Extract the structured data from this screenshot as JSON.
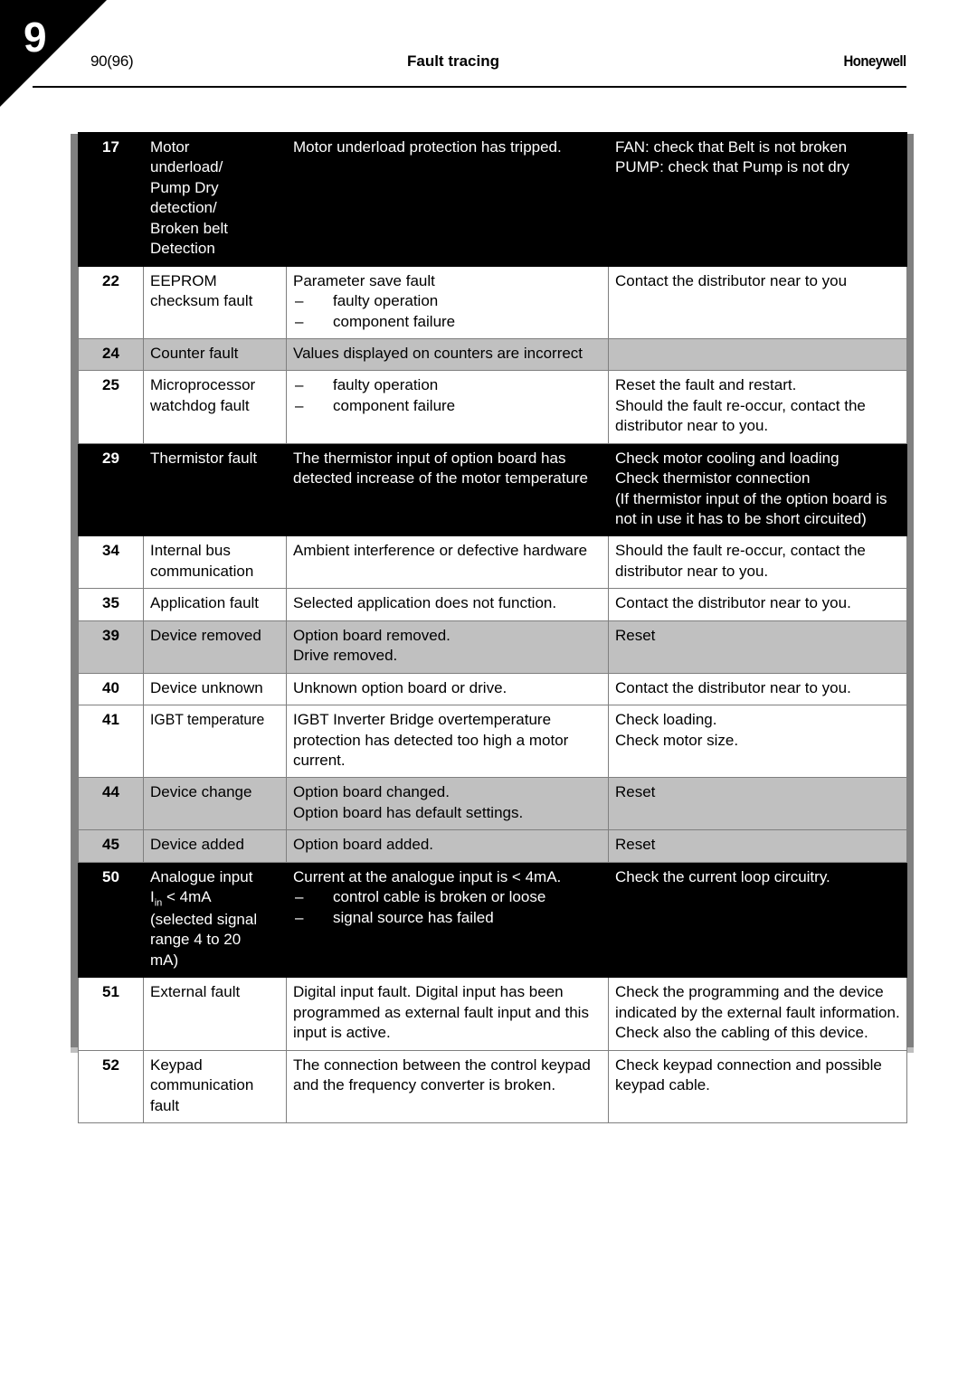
{
  "header": {
    "chapter_number": "9",
    "page_number": "90(96)",
    "title": "Fault tracing",
    "brand": "Honeywell"
  },
  "table": {
    "rows": [
      {
        "code": "17",
        "shade": "black",
        "name_lines": [
          "Motor",
          "underload/",
          "Pump Dry",
          "detection/",
          "Broken belt",
          "Detection"
        ],
        "desc_lines": [
          "Motor underload protection has tripped."
        ],
        "desc_bullets": [],
        "help_lines": [
          "FAN: check that Belt is not broken",
          "PUMP: check that Pump is not dry"
        ]
      },
      {
        "code": "22",
        "shade": "white",
        "name_lines": [
          "EEPROM",
          "checksum fault"
        ],
        "desc_lines": [
          "Parameter save fault"
        ],
        "desc_bullets": [
          "faulty operation",
          "component failure"
        ],
        "help_lines": [
          "Contact the distributor near to you"
        ]
      },
      {
        "code": "24",
        "shade": "gray",
        "name_lines": [
          "Counter fault"
        ],
        "desc_lines": [
          "Values displayed on counters are incorrect"
        ],
        "desc_bullets": [],
        "help_lines": []
      },
      {
        "code": "25",
        "shade": "white",
        "name_lines": [
          "Microprocessor",
          "watchdog fault"
        ],
        "desc_lines": [],
        "desc_bullets": [
          "faulty operation",
          "component failure"
        ],
        "help_lines": [
          "Reset the fault and restart.",
          "Should the fault re-occur, contact the distributor near to you."
        ]
      },
      {
        "code": "29",
        "shade": "black",
        "name_lines": [
          "Thermistor fault"
        ],
        "desc_lines": [
          "The thermistor input of option board has detected increase of the motor temperature"
        ],
        "desc_bullets": [],
        "help_lines": [
          "Check motor cooling and loading",
          "Check thermistor connection",
          "(If thermistor input of the option board is not in use it has to be short circuited)"
        ]
      },
      {
        "code": "34",
        "shade": "white",
        "name_lines": [
          "Internal bus",
          "communication"
        ],
        "desc_lines": [
          "Ambient interference or defective hardware"
        ],
        "desc_bullets": [],
        "help_lines": [
          "Should the fault re-occur, contact the distributor near to you."
        ]
      },
      {
        "code": "35",
        "shade": "white",
        "name_lines": [
          "Application fault"
        ],
        "desc_lines": [
          "Selected application does not function."
        ],
        "desc_bullets": [],
        "help_lines": [
          "Contact the distributor near to you."
        ]
      },
      {
        "code": "39",
        "shade": "gray",
        "name_lines": [
          "Device removed"
        ],
        "desc_lines": [
          "Option board removed.",
          "Drive removed."
        ],
        "desc_bullets": [],
        "help_lines": [
          "Reset"
        ]
      },
      {
        "code": "40",
        "shade": "white",
        "name_lines": [
          "Device unknown"
        ],
        "desc_lines": [
          "Unknown option board or drive."
        ],
        "desc_bullets": [],
        "help_lines": [
          "Contact the distributor near to you."
        ]
      },
      {
        "code": "41",
        "shade": "white",
        "name_lines": [
          "IGBT temperature"
        ],
        "name_condensed": true,
        "desc_lines": [
          "IGBT Inverter Bridge overtemperature protection has detected too high a motor current."
        ],
        "desc_bullets": [],
        "help_lines": [
          "Check loading.",
          "Check motor size."
        ]
      },
      {
        "code": "44",
        "shade": "gray",
        "name_lines": [
          "Device change"
        ],
        "desc_lines": [
          "Option board changed.",
          "Option board has default settings."
        ],
        "desc_bullets": [],
        "help_lines": [
          "Reset"
        ]
      },
      {
        "code": "45",
        "shade": "gray",
        "name_lines": [
          "Device added"
        ],
        "desc_lines": [
          "Option board added."
        ],
        "desc_bullets": [],
        "help_lines": [
          "Reset"
        ]
      },
      {
        "code": "50",
        "shade": "black",
        "name_lines": [
          "Analogue input",
          "I|in| < 4mA",
          "(selected signal",
          "range 4 to 20",
          "mA)"
        ],
        "desc_lines": [
          "Current at the analogue input is < 4mA."
        ],
        "desc_bullets": [
          "control cable is broken or loose",
          "signal source has failed"
        ],
        "help_lines": [
          "Check the current loop circuitry."
        ]
      },
      {
        "code": "51",
        "shade": "white",
        "name_lines": [
          "External fault"
        ],
        "desc_lines": [
          "Digital input fault. Digital input has been programmed as external fault input and this input is active."
        ],
        "desc_bullets": [],
        "help_lines": [
          "Check the programming and the device indicated by the external fault information. Check also the cabling of this device."
        ]
      },
      {
        "code": "52",
        "shade": "white",
        "name_lines": [
          "Keypad",
          "communication",
          "fault"
        ],
        "desc_lines": [
          "The connection between the control keypad and the frequency converter is broken."
        ],
        "desc_bullets": [],
        "help_lines": [
          "Check keypad connection and possible keypad cable."
        ]
      }
    ]
  },
  "bullet_glyph": "–"
}
